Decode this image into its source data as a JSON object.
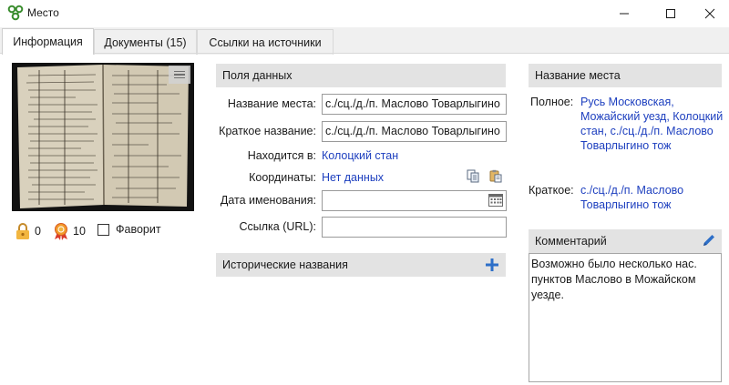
{
  "window": {
    "title": "Место",
    "icon": "app-icon",
    "controls": [
      "minimize",
      "maximize",
      "close"
    ]
  },
  "tabs": [
    {
      "label": "Информация",
      "active": true
    },
    {
      "label": "Документы (15)",
      "active": false
    },
    {
      "label": "Ссылки на источники",
      "active": false
    }
  ],
  "left": {
    "lock_count": "0",
    "award_count": "10",
    "favorite_label": "Фаворит",
    "favorite_checked": false
  },
  "fields": {
    "header": "Поля данных",
    "name_label": "Название места:",
    "name_value": "с./сц./д./п. Маслово Товарлыгино",
    "short_label": "Краткое название:",
    "short_value": "с./сц./д./п. Маслово Товарлыгино",
    "located_label": "Находится в:",
    "located_value": "Колоцкий стан",
    "coords_label": "Координаты:",
    "coords_value": "Нет данных",
    "date_label": "Дата именования:",
    "date_value": "",
    "url_label": "Ссылка (URL):",
    "url_value": ""
  },
  "historical": {
    "header": "Исторические названия"
  },
  "place_name": {
    "header": "Название места",
    "full_label": "Полное:",
    "full_value": "Русь Московская, Можайский уезд, Колоцкий стан, с./сц./д./п. Маслово Товарлыгино тож",
    "short_label": "Краткое:",
    "short_value": "с./сц./д./п. Маслово Товарлыгино тож"
  },
  "comment": {
    "header": "Комментарий",
    "text": "Возможно было несколько нас. пунктов Маслово в Можайском уезде."
  },
  "colors": {
    "link": "#1d3fbf",
    "section_header": "#e3e3e3",
    "accent": "#2d6fc8"
  }
}
